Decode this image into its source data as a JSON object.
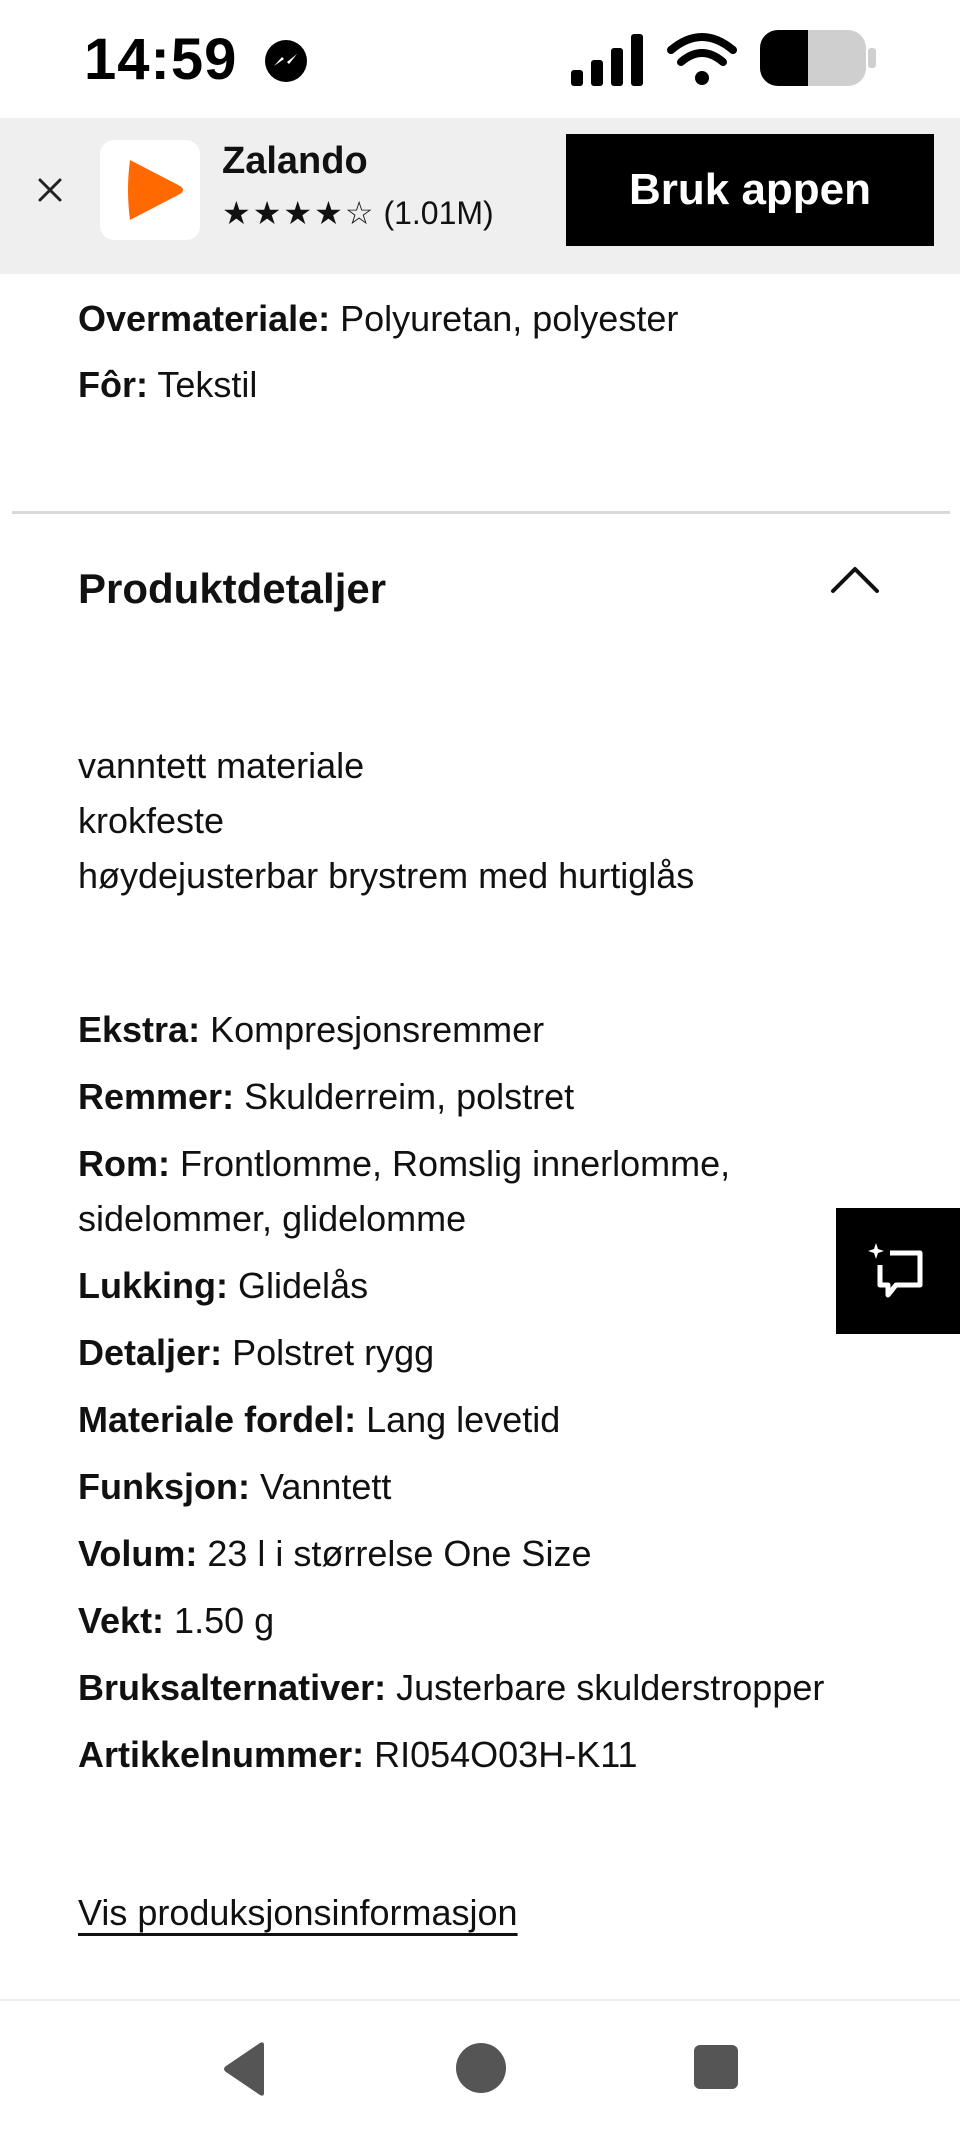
{
  "status_bar": {
    "time": "14:59"
  },
  "app_banner": {
    "app_name": "Zalando",
    "stars": "★★★★☆",
    "rating_count": "(1.01M)",
    "cta_label": "Bruk appen",
    "brand_color": "#ff6900"
  },
  "materials": [
    {
      "label": "Overmateriale:",
      "value": " Polyuretan, polyester"
    },
    {
      "label": "Fôr:",
      "value": " Tekstil"
    }
  ],
  "product_details": {
    "title": "Produktdetaljer",
    "description": [
      "vanntett materiale",
      "krokfeste",
      "høydejusterbar brystrem med hurtiglås"
    ],
    "specs": [
      {
        "label": "Ekstra:",
        "value": " Kompresjonsremmer"
      },
      {
        "label": "Remmer:",
        "value": " Skulderreim, polstret"
      },
      {
        "label": "Rom:",
        "value": " Frontlomme, Romslig innerlomme, sidelommer, glidelomme"
      },
      {
        "label": "Lukking:",
        "value": " Glidelås"
      },
      {
        "label": "Detaljer:",
        "value": " Polstret rygg"
      },
      {
        "label": "Materiale fordel:",
        "value": " Lang levetid"
      },
      {
        "label": "Funksjon:",
        "value": " Vanntett"
      },
      {
        "label": "Volum:",
        "value": " 23 l i størrelse One Size"
      },
      {
        "label": "Vekt:",
        "value": " 1.50 g"
      },
      {
        "label": "Bruksalternativer:",
        "value": " Justerbare skulderstropper"
      },
      {
        "label": "Artikkelnummer:",
        "value": " RI054O03H-K11"
      }
    ],
    "production_link": "Vis produksjonsinformasjon"
  }
}
